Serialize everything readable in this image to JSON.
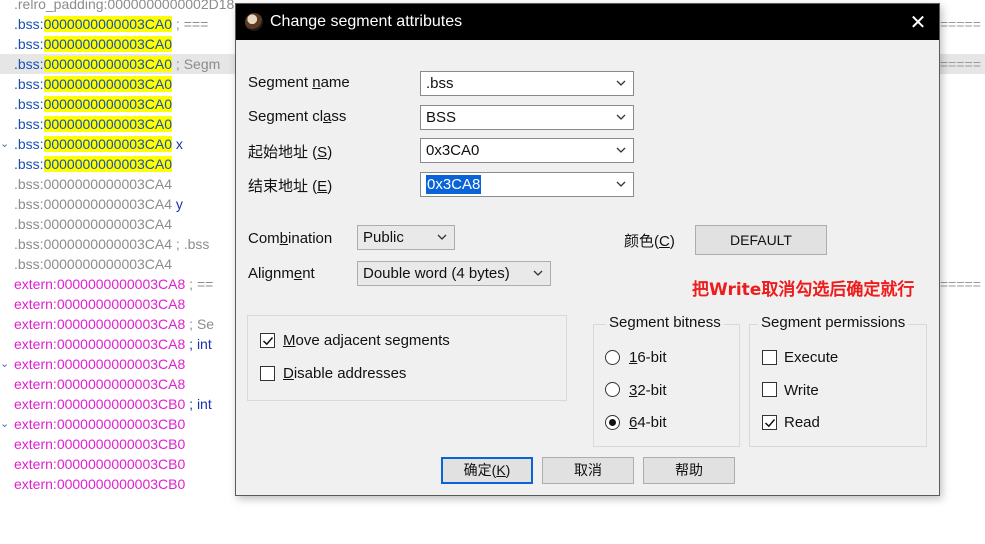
{
  "listing": {
    "lines": [
      {
        "arrow": "",
        "seg": ".relro_padding:",
        "addr": "0000000000002D18",
        "hl": false,
        "seg_style": "gray",
        "tail": ""
      },
      {
        "arrow": "",
        "seg": ".bss:",
        "addr": "0000000000003CA0",
        "hl": true,
        "seg_style": "bss",
        "tail": " ; ===",
        "tail_style": "cmt"
      },
      {
        "arrow": "",
        "seg": ".bss:",
        "addr": "0000000000003CA0",
        "hl": true,
        "seg_style": "bss",
        "tail": ""
      },
      {
        "arrow": "",
        "seg": ".bss:",
        "addr": "0000000000003CA0",
        "hl": true,
        "seg_style": "bss",
        "tail": " ; Segm",
        "tail_style": "cmt",
        "current": true
      },
      {
        "arrow": "",
        "seg": ".bss:",
        "addr": "0000000000003CA0",
        "hl": true,
        "seg_style": "bss",
        "tail": ""
      },
      {
        "arrow": "",
        "seg": ".bss:",
        "addr": "0000000000003CA0",
        "hl": true,
        "seg_style": "bss",
        "tail": ""
      },
      {
        "arrow": "",
        "seg": ".bss:",
        "addr": "0000000000003CA0",
        "hl": true,
        "seg_style": "bss",
        "tail": ""
      },
      {
        "arrow": "⌄",
        "seg": ".bss:",
        "addr": "0000000000003CA0",
        "hl": true,
        "seg_style": "bss",
        "tail": " x",
        "tail_style": "sym"
      },
      {
        "arrow": "",
        "seg": ".bss:",
        "addr": "0000000000003CA0",
        "hl": true,
        "seg_style": "bss",
        "tail": ""
      },
      {
        "arrow": "",
        "seg": ".bss:",
        "addr": "0000000000003CA4",
        "hl": false,
        "seg_style": "gray",
        "tail": ""
      },
      {
        "arrow": "",
        "seg": ".bss:",
        "addr": "0000000000003CA4",
        "hl": false,
        "seg_style": "gray",
        "tail": " y",
        "tail_style": "sym"
      },
      {
        "arrow": "",
        "seg": ".bss:",
        "addr": "0000000000003CA4",
        "hl": false,
        "seg_style": "gray",
        "tail": ""
      },
      {
        "arrow": "",
        "seg": ".bss:",
        "addr": "0000000000003CA4",
        "hl": false,
        "seg_style": "gray",
        "tail": " ; .bss",
        "tail_style": "cmt"
      },
      {
        "arrow": "",
        "seg": ".bss:",
        "addr": "0000000000003CA4",
        "hl": false,
        "seg_style": "gray",
        "tail": ""
      },
      {
        "arrow": "",
        "seg": "extern:",
        "addr": "0000000000003CA8",
        "hl": false,
        "seg_style": "ext",
        "tail": " ; ==",
        "tail_style": "cmt"
      },
      {
        "arrow": "",
        "seg": "extern:",
        "addr": "0000000000003CA8",
        "hl": false,
        "seg_style": "ext",
        "tail": ""
      },
      {
        "arrow": "",
        "seg": "extern:",
        "addr": "0000000000003CA8",
        "hl": false,
        "seg_style": "ext",
        "tail": " ; Se",
        "tail_style": "cmt"
      },
      {
        "arrow": "",
        "seg": "extern:",
        "addr": "0000000000003CA8",
        "hl": false,
        "seg_style": "ext",
        "tail": " ; int",
        "tail_style": "sym"
      },
      {
        "arrow": "⌄",
        "seg": "extern:",
        "addr": "0000000000003CA8",
        "hl": false,
        "seg_style": "ext",
        "tail": ""
      },
      {
        "arrow": "",
        "seg": "extern:",
        "addr": "0000000000003CA8",
        "hl": false,
        "seg_style": "ext",
        "tail": ""
      },
      {
        "arrow": "",
        "seg": "extern:",
        "addr": "0000000000003CB0",
        "hl": false,
        "seg_style": "ext",
        "tail": " ; int",
        "tail_style": "sym"
      },
      {
        "arrow": "⌄",
        "seg": "extern:",
        "addr": "0000000000003CB0",
        "hl": false,
        "seg_style": "ext",
        "tail": ""
      },
      {
        "arrow": "",
        "seg": "extern:",
        "addr": "0000000000003CB0",
        "hl": false,
        "seg_style": "ext",
        "tail": ""
      },
      {
        "arrow": "",
        "seg": "extern:",
        "addr": "0000000000003CB0",
        "hl": false,
        "seg_style": "ext",
        "tail": ""
      },
      {
        "arrow": "",
        "seg": "extern:",
        "addr": "0000000000003CB0",
        "hl": false,
        "seg_style": "ext",
        "tail": ""
      }
    ],
    "right_fragments": [
      "=====",
      "=====",
      "====="
    ]
  },
  "dialog": {
    "title": "Change segment attributes",
    "fields": {
      "segment_name": {
        "label_pre": "Segment ",
        "label_u": "n",
        "label_post": "ame",
        "value": ".bss"
      },
      "segment_class": {
        "label_pre": "Segment cl",
        "label_u": "a",
        "label_post": "ss",
        "value": "BSS"
      },
      "start_address": {
        "label_pre": "起始地址 (",
        "label_u": "S",
        "label_post": ")",
        "value": "0x3CA0"
      },
      "end_address": {
        "label_pre": "结束地址 (",
        "label_u": "E",
        "label_post": ")",
        "value": "0x3CA8"
      }
    },
    "combination": {
      "label_pre": "Com",
      "label_u": "b",
      "label_post": "ination",
      "value": "Public"
    },
    "alignment": {
      "label_pre": "Alignm",
      "label_u": "e",
      "label_post": "nt",
      "value": "Double word (4 bytes)"
    },
    "color": {
      "label_pre": "颜色(",
      "label_u": "C",
      "label_post": ")",
      "button": "DEFAULT"
    },
    "options": {
      "move_adjacent": {
        "label_u": "M",
        "label_post": "ove adjacent segments",
        "checked": true
      },
      "disable_addresses": {
        "label_u": "D",
        "label_post": "isable addresses",
        "checked": false
      }
    },
    "bitness": {
      "title": "Segment bitness",
      "items": [
        {
          "label_u": "1",
          "label_post": "6-bit",
          "selected": false
        },
        {
          "label_u": "3",
          "label_post": "2-bit",
          "selected": false
        },
        {
          "label_u": "6",
          "label_post": "4-bit",
          "selected": true
        }
      ]
    },
    "permissions": {
      "title": "Segment permissions",
      "items": [
        {
          "label": "Execute",
          "checked": false
        },
        {
          "label": "Write",
          "checked": false
        },
        {
          "label": "Read",
          "checked": true
        }
      ]
    },
    "buttons": {
      "ok_pre": "确定(",
      "ok_u": "K",
      "ok_post": ")",
      "cancel": "取消",
      "help": "帮助"
    }
  },
  "annotation": "把Write取消勾选后确定就行"
}
